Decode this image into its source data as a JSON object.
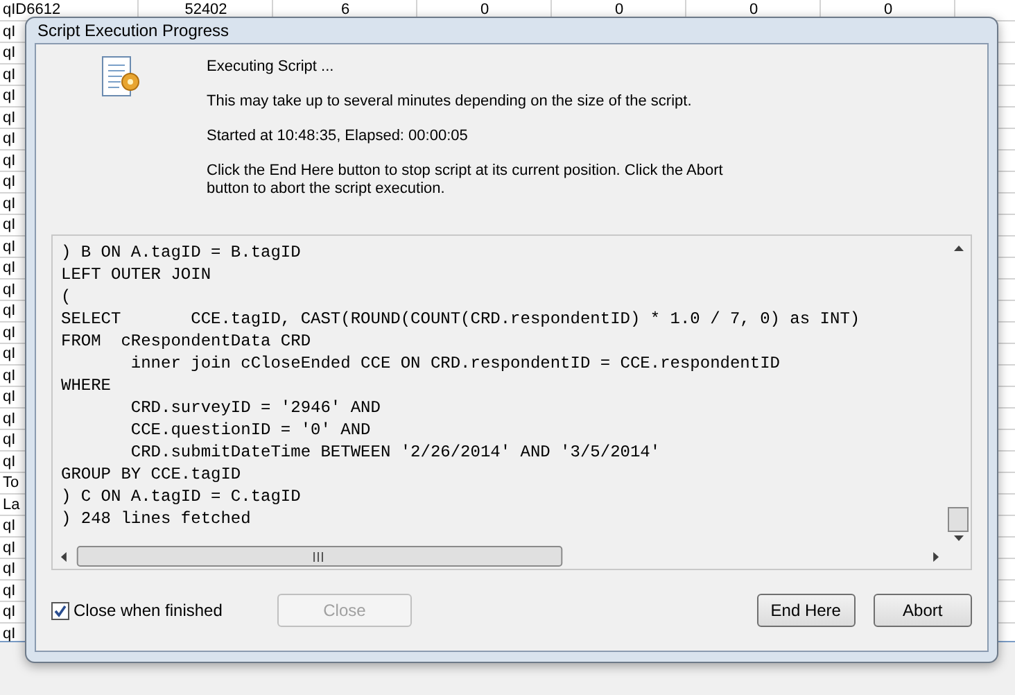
{
  "sheet": {
    "header_row": [
      "qID6612",
      "52402",
      "6",
      "0",
      "0",
      "0",
      "0"
    ],
    "row_labels": [
      "qI",
      "qI",
      "qI",
      "qI",
      "qI",
      "qI",
      "qI",
      "qI",
      "qI",
      "qI",
      "qI",
      "qI",
      "qI",
      "qI",
      "qI",
      "qI",
      "qI",
      "qI",
      "qI",
      "qI",
      "qI",
      "To",
      "La",
      "qI",
      "qI",
      "qI",
      "qI",
      "qI",
      "qI"
    ]
  },
  "dialog": {
    "title": "Script Execution Progress",
    "messages": [
      "Executing Script ...",
      "This may take up to several minutes depending on the size of the script.",
      "Started at 10:48:35, Elapsed: 00:00:05",
      "Click the End Here button to stop script at its current position. Click the Abort button to abort the script execution."
    ],
    "log_lines": [
      ") B ON A.tagID = B.tagID",
      "LEFT OUTER JOIN",
      "(",
      "SELECT       CCE.tagID, CAST(ROUND(COUNT(CRD.respondentID) * 1.0 / 7, 0) as INT)",
      "FROM  cRespondentData CRD",
      "       inner join cCloseEnded CCE ON CRD.respondentID = CCE.respondentID",
      "WHERE",
      "       CRD.surveyID = '2946' AND",
      "       CCE.questionID = '0' AND",
      "       CRD.submitDateTime BETWEEN '2/26/2014' AND '3/5/2014'",
      "GROUP BY CCE.tagID",
      ") C ON A.tagID = C.tagID",
      ") 248 lines fetched"
    ],
    "close_when_finished": {
      "label": "Close when finished",
      "checked": true
    },
    "buttons": [
      {
        "kind": "close",
        "label": "Close",
        "disabled": true
      },
      {
        "kind": "end",
        "label": "End Here",
        "disabled": false
      },
      {
        "kind": "abort",
        "label": "Abort",
        "disabled": false
      }
    ]
  }
}
